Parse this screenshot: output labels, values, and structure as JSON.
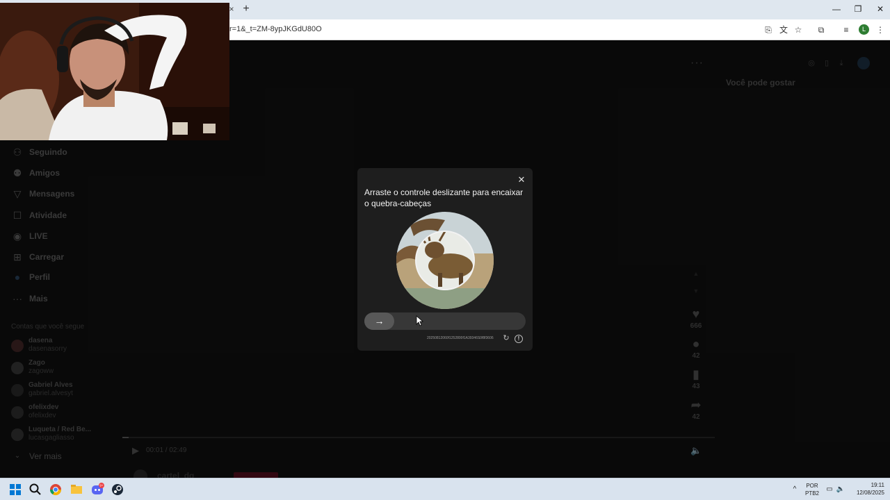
{
  "browser": {
    "tab_close": "×",
    "new_tab": "+",
    "url": "r=1&_t=ZM-8ypJKGdU80O",
    "minimize": "—",
    "restore": "❐",
    "close": "✕",
    "profile_initial": "L"
  },
  "sidebar": {
    "items": [
      {
        "label": "Seguindo",
        "icon": "user-follow-icon",
        "glyph": "⚇"
      },
      {
        "label": "Amigos",
        "icon": "friends-icon",
        "glyph": "⚉"
      },
      {
        "label": "Mensagens",
        "icon": "send-icon",
        "glyph": "▽"
      },
      {
        "label": "Atividade",
        "icon": "activity-icon",
        "glyph": "☐"
      },
      {
        "label": "LIVE",
        "icon": "live-icon",
        "glyph": "◉"
      },
      {
        "label": "Carregar",
        "icon": "upload-icon",
        "glyph": "⊞"
      },
      {
        "label": "Perfil",
        "icon": "profile-icon",
        "glyph": "●"
      },
      {
        "label": "Mais",
        "icon": "more-icon",
        "glyph": "···"
      }
    ],
    "following_title": "Contas que você segue",
    "accounts": [
      {
        "name": "dasena",
        "user": "dasenasorry"
      },
      {
        "name": "Zago",
        "user": "zagoww"
      },
      {
        "name": "Gabriel Alves",
        "user": "gabriel.alvesyt"
      },
      {
        "name": "ofelixdev",
        "user": "ofelixdev"
      },
      {
        "name": "Luqueta / Red Be...",
        "user": "lucasgagliasso"
      }
    ],
    "see_more": "Ver mais",
    "see_more_glyph": "⌄"
  },
  "right_panel": {
    "recommend_title": "Você pode gostar",
    "more_dots": "···"
  },
  "actions": {
    "likes": "666",
    "comments": "42",
    "saves": "43",
    "shares": "42",
    "like_glyph": "♥",
    "comment_glyph": "●",
    "save_glyph": "▮",
    "share_glyph": "➦"
  },
  "player": {
    "play_glyph": "▶",
    "time": "00:01 / 02:49",
    "progress": 0.01,
    "volume_glyph": "🔈"
  },
  "caption": {
    "username": "cartel_dg"
  },
  "modal": {
    "close_glyph": "✕",
    "title": "Arraste o controle deslizante para encaixar o quebra-cabeças",
    "slider_arrow": "→",
    "captcha_id": "20250812060f1252800f1A39346S0f8f3606",
    "refresh_glyph": "↻",
    "info_glyph": "!"
  },
  "taskbar": {
    "lang_top": "POR",
    "lang_bottom": "PTB2",
    "time": "19:11",
    "date": "12/08/2025",
    "discord_badge": "9+",
    "tray_up": "^"
  }
}
